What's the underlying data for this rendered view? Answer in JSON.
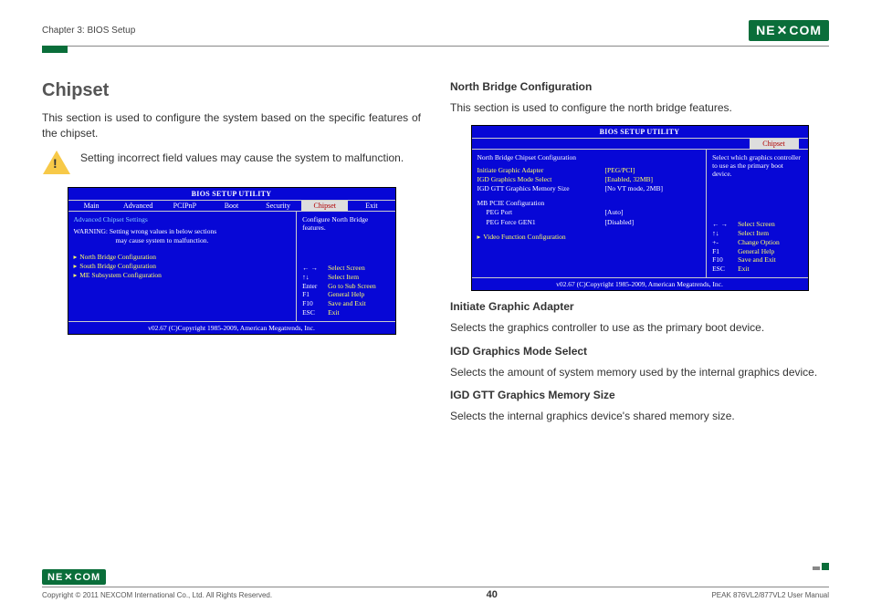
{
  "header": {
    "chapter": "Chapter 3: BIOS Setup",
    "logo_text": "NE COM"
  },
  "left": {
    "heading": "Chipset",
    "intro": "This section is used to configure the system based on the specific features of the chipset.",
    "warning": "Setting incorrect field values may cause the system to malfunc­tion."
  },
  "bios_left": {
    "title": "BIOS SETUP UTILITY",
    "tabs": [
      "Main",
      "Advanced",
      "PCIPnP",
      "Boot",
      "Security",
      "Chipset",
      "Exit"
    ],
    "active_tab": "Chipset",
    "section_title": "Advanced Chipset Settings",
    "warning_l1": "WARNING:  Setting wrong values in below sections",
    "warning_l2": "may cause system to malfunction.",
    "submenus": [
      "North Bridge Configuration",
      "South Bridge Configuration",
      "ME Subsystem Configuration"
    ],
    "help": "Configure North Bridge features.",
    "nav": [
      {
        "key": "← →",
        "act": "Select Screen"
      },
      {
        "key": "↑↓",
        "act": "Select Item"
      },
      {
        "key": "Enter",
        "act": "Go to Sub Screen"
      },
      {
        "key": "F1",
        "act": "General Help"
      },
      {
        "key": "F10",
        "act": "Save and Exit"
      },
      {
        "key": "ESC",
        "act": "Exit"
      }
    ],
    "footer": "v02.67 (C)Copyright 1985-2009, American Megatrends, Inc."
  },
  "right": {
    "heading": "North Bridge Configuration",
    "intro": "This section is used to configure the north bridge features.",
    "s1_h": "Initiate Graphic Adapter",
    "s1_p": "Selects the graphics controller to use as the primary boot device.",
    "s2_h": "IGD Graphics Mode Select",
    "s2_p": "Selects the amount of system memory used by the internal graphics de­vice.",
    "s3_h": "IGD GTT Graphics Memory Size",
    "s3_p": "Selects the internal graphics device's shared memory size."
  },
  "bios_right": {
    "title": "BIOS SETUP UTILITY",
    "tab": "Chipset",
    "section_title": "North Bridge Chipset Configuration",
    "rows": [
      {
        "label": "Initiate Graphic Adapter",
        "val": "[PEG/PCI]"
      },
      {
        "label": "IGD Graphics Mode Select",
        "val": "[Enabled, 32MB]"
      },
      {
        "label": "IGD GTT Graphics Memory Size",
        "val": "[No VT mode, 2MB]"
      }
    ],
    "pcie_head": "MB PCIE Configuration",
    "pcie_rows": [
      {
        "label": "PEG Port",
        "val": "[Auto]"
      },
      {
        "label": "PEG Force GEN1",
        "val": "[Disabled]"
      }
    ],
    "submenu": "Video Function Configuration",
    "help": "Select which graphics controller to use as the primary boot device.",
    "nav": [
      {
        "key": "← →",
        "act": "Select Screen"
      },
      {
        "key": "↑↓",
        "act": "Select Item"
      },
      {
        "key": "+-",
        "act": "Change Option"
      },
      {
        "key": "F1",
        "act": "General Help"
      },
      {
        "key": "F10",
        "act": "Save and Exit"
      },
      {
        "key": "ESC",
        "act": "Exit"
      }
    ],
    "footer": "v02.67 (C)Copyright 1985-2009, American Megatrends, Inc."
  },
  "footer": {
    "logo_text": "NE COM",
    "copyright": "Copyright © 2011 NEXCOM International Co., Ltd. All Rights Reserved.",
    "page": "40",
    "manual": "PEAK 876VL2/877VL2 User Manual"
  }
}
